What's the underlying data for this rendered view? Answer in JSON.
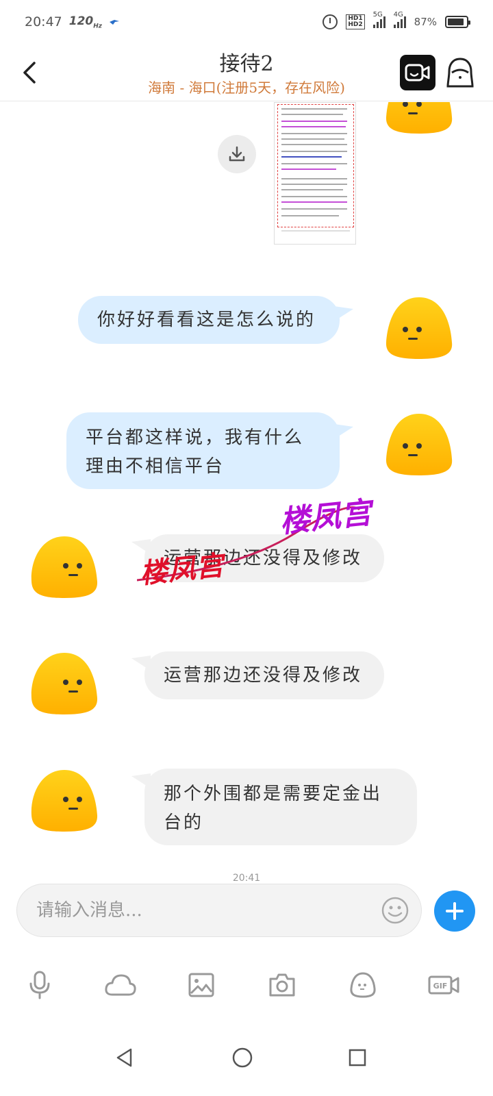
{
  "status_bar": {
    "time": "20:47",
    "refresh_rate": "120",
    "refresh_unit": "Hz",
    "net1": "5G",
    "net2": "4G",
    "battery": "87%",
    "battery_level": 0.87
  },
  "header": {
    "title": "接待2",
    "subtitle": "海南 - 海口(注册5天，存在风险)"
  },
  "messages": [
    {
      "sender": "self",
      "type": "image"
    },
    {
      "sender": "self",
      "text": "你好好看看这是怎么说的"
    },
    {
      "sender": "self",
      "text": "平台都这样说，我有什么理由不相信平台"
    },
    {
      "sender": "other",
      "text": "运营那边还没得及修改"
    },
    {
      "sender": "other",
      "text": "运营那边还没得及修改"
    },
    {
      "sender": "other",
      "text": "那个外围都是需要定金出台的"
    }
  ],
  "timestamp_partial": "20:41",
  "watermarks": [
    "楼凤宫",
    "楼凤宫"
  ],
  "input": {
    "placeholder": "请输入消息..."
  },
  "toolbar": {
    "items": [
      "microphone-icon",
      "cloud-icon",
      "image-icon",
      "camera-icon",
      "sticker-icon",
      "gif-icon"
    ],
    "gif_label": "GIF"
  },
  "colors": {
    "outgoing_bubble": "#dbeeff",
    "incoming_bubble": "#f1f1f1",
    "accent": "#2196f3",
    "subtitle": "#d07a3a",
    "watermark_purple": "#b40fd6",
    "watermark_red": "#e0102a"
  }
}
